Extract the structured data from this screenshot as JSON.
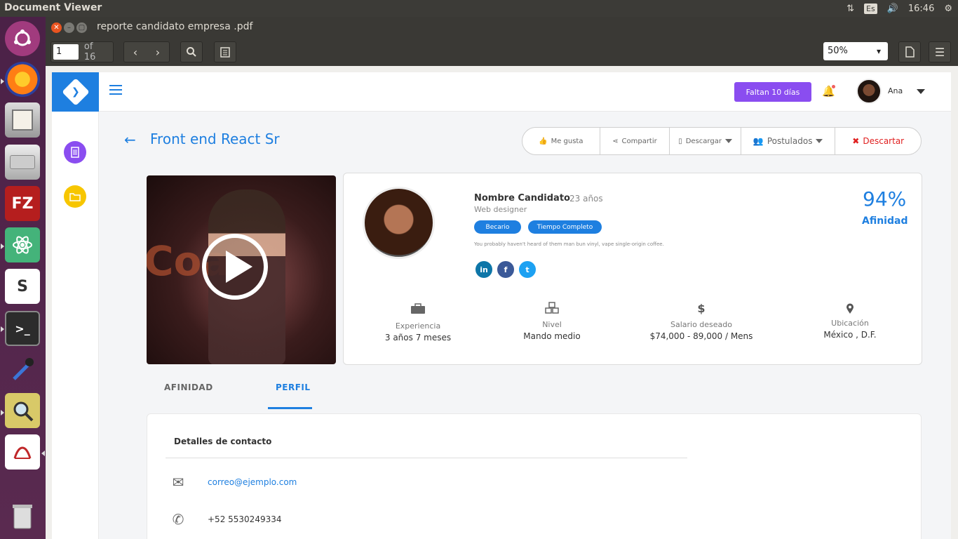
{
  "system": {
    "app_title": "Document Viewer",
    "keyboard_layout": "Es",
    "clock": "16:46"
  },
  "launcher": {
    "apps": [
      "ubuntu-icon",
      "firefox-icon",
      "file-cabinet-icon",
      "disk-icon",
      "filezilla-icon",
      "atom-icon",
      "slack-icon",
      "terminal-icon",
      "color-picker-icon",
      "image-viewer-icon",
      "pdf-icon",
      "trash-icon"
    ],
    "labels": {
      "filezilla": "FZ",
      "slack": "S",
      "terminal": ">_"
    }
  },
  "window": {
    "title": "reporte candidato empresa .pdf",
    "page_current": "1",
    "page_total": "of 16",
    "zoom": "50%"
  },
  "app_header": {
    "trial_badge": "Faltan 10 días",
    "user_name": "Ana"
  },
  "job": {
    "title": "Front end React Sr"
  },
  "actions": {
    "like": "Me gusta",
    "share": "Compartir",
    "download": "Descargar",
    "applicants": "Postulados",
    "discard": "Descartar"
  },
  "video": {
    "stage_text": "Coa"
  },
  "candidate": {
    "name": "Nombre Candidato",
    "age": "23 años",
    "role": "Web designer",
    "tags": [
      "Becario",
      "Tiempo Completo"
    ],
    "bio": "You probably haven't heard of them man bun vinyl, vape single-origin coffee.",
    "social": {
      "linkedin": "in",
      "facebook": "f",
      "twitter": "t"
    },
    "affinity_pct": "94%",
    "affinity_label": "Afinidad",
    "stats": [
      {
        "icon": "briefcase-icon",
        "label": "Experiencia",
        "value": "3 años 7 meses"
      },
      {
        "icon": "cubes-icon",
        "label": "Nivel",
        "value": "Mando medio"
      },
      {
        "icon": "dollar-icon",
        "label": "Salario deseado",
        "value": "$74,000 - 89,000 / Mens"
      },
      {
        "icon": "location-pin-icon",
        "label": "Ubicación",
        "value": "México , D.F."
      }
    ]
  },
  "tabs": {
    "affinity": "AFINIDAD",
    "profile": "PERFIL",
    "active": "profile"
  },
  "contact": {
    "title": "Detalles de contacto",
    "email": "correo@ejemplo.com",
    "phone": "+52  5530249334"
  },
  "colors": {
    "primary": "#1e7fe0",
    "purple": "#8a4df0",
    "danger": "#e02020",
    "yellow": "#f7c600"
  }
}
